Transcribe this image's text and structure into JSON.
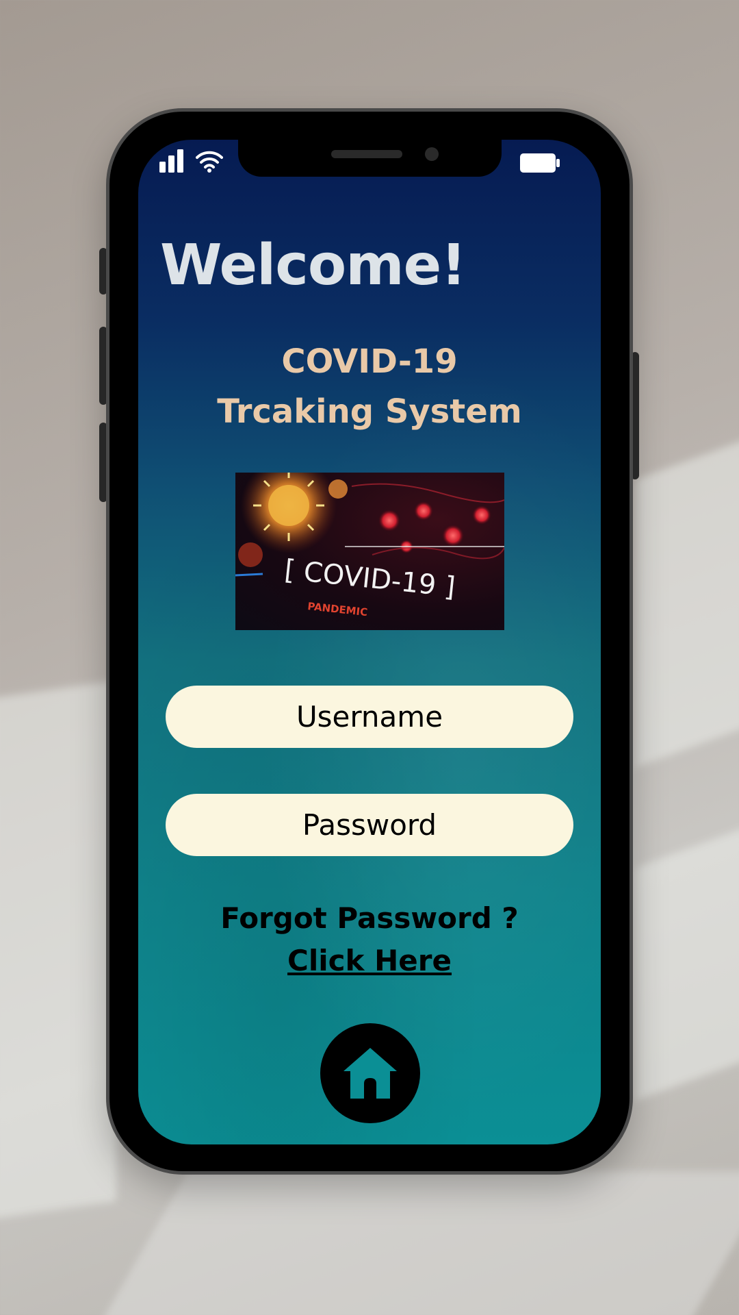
{
  "status_bar": {
    "signal_icon": "signal-bars-icon",
    "wifi_icon": "wifi-icon",
    "battery_icon": "battery-icon"
  },
  "header": {
    "welcome": "Welcome!",
    "subtitle_line1": "COVID-19",
    "subtitle_line2": "Trcaking System"
  },
  "hero_image": {
    "label": "[ COVID-19 ]",
    "caption": "PANDEMIC"
  },
  "form": {
    "username": {
      "value": "",
      "placeholder": "Username"
    },
    "password": {
      "value": "",
      "placeholder": "Password"
    }
  },
  "forgot": {
    "prompt": "Forgot Password ?",
    "link": "Click Here"
  },
  "footer": {
    "home_icon": "home-icon"
  },
  "colors": {
    "screen_top": "#061b52",
    "screen_bottom": "#0b8f95",
    "title": "#dde3e8",
    "subtitle": "#e9c9a8",
    "field_bg": "#fbf6df"
  }
}
